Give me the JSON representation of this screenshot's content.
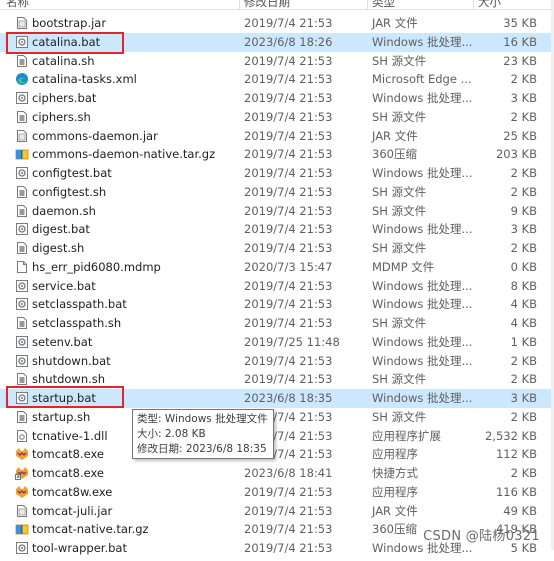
{
  "header": {
    "name": "名称",
    "date": "修改日期",
    "type": "类型",
    "size": "大小"
  },
  "rows": [
    {
      "name": "bootstrap.jar",
      "date": "2019/7/4 21:53",
      "type": "JAR 文件",
      "size": "35 KB",
      "icon": "jar-file-icon"
    },
    {
      "name": "catalina.bat",
      "date": "2023/6/8 18:26",
      "type": "Windows 批处理...",
      "size": "16 KB",
      "icon": "batch-file-icon"
    },
    {
      "name": "catalina.sh",
      "date": "2019/7/4 21:53",
      "type": "SH 源文件",
      "size": "23 KB",
      "icon": "sh-file-icon"
    },
    {
      "name": "catalina-tasks.xml",
      "date": "2019/7/4 21:53",
      "type": "Microsoft Edge ...",
      "size": "2 KB",
      "icon": "edge-xml-icon"
    },
    {
      "name": "ciphers.bat",
      "date": "2019/7/4 21:53",
      "type": "Windows 批处理...",
      "size": "3 KB",
      "icon": "batch-file-icon"
    },
    {
      "name": "ciphers.sh",
      "date": "2019/7/4 21:53",
      "type": "SH 源文件",
      "size": "2 KB",
      "icon": "sh-file-icon"
    },
    {
      "name": "commons-daemon.jar",
      "date": "2019/7/4 21:53",
      "type": "JAR 文件",
      "size": "25 KB",
      "icon": "jar-file-icon"
    },
    {
      "name": "commons-daemon-native.tar.gz",
      "date": "2019/7/4 21:53",
      "type": "360压缩",
      "size": "203 KB",
      "icon": "archive-file-icon"
    },
    {
      "name": "configtest.bat",
      "date": "2019/7/4 21:53",
      "type": "Windows 批处理...",
      "size": "2 KB",
      "icon": "batch-file-icon"
    },
    {
      "name": "configtest.sh",
      "date": "2019/7/4 21:53",
      "type": "SH 源文件",
      "size": "2 KB",
      "icon": "sh-file-icon"
    },
    {
      "name": "daemon.sh",
      "date": "2019/7/4 21:53",
      "type": "SH 源文件",
      "size": "9 KB",
      "icon": "sh-file-icon"
    },
    {
      "name": "digest.bat",
      "date": "2019/7/4 21:53",
      "type": "Windows 批处理...",
      "size": "3 KB",
      "icon": "batch-file-icon"
    },
    {
      "name": "digest.sh",
      "date": "2019/7/4 21:53",
      "type": "SH 源文件",
      "size": "2 KB",
      "icon": "sh-file-icon"
    },
    {
      "name": "hs_err_pid6080.mdmp",
      "date": "2020/7/3 15:47",
      "type": "MDMP 文件",
      "size": "0 KB",
      "icon": "blank-file-icon"
    },
    {
      "name": "service.bat",
      "date": "2019/7/4 21:53",
      "type": "Windows 批处理...",
      "size": "8 KB",
      "icon": "batch-file-icon"
    },
    {
      "name": "setclasspath.bat",
      "date": "2019/7/4 21:53",
      "type": "Windows 批处理...",
      "size": "4 KB",
      "icon": "batch-file-icon"
    },
    {
      "name": "setclasspath.sh",
      "date": "2019/7/4 21:53",
      "type": "SH 源文件",
      "size": "4 KB",
      "icon": "sh-file-icon"
    },
    {
      "name": "setenv.bat",
      "date": "2019/7/25 11:48",
      "type": "Windows 批处理...",
      "size": "1 KB",
      "icon": "batch-file-icon"
    },
    {
      "name": "shutdown.bat",
      "date": "2019/7/4 21:53",
      "type": "Windows 批处理...",
      "size": "2 KB",
      "icon": "batch-file-icon"
    },
    {
      "name": "shutdown.sh",
      "date": "2019/7/4 21:53",
      "type": "SH 源文件",
      "size": "2 KB",
      "icon": "sh-file-icon"
    },
    {
      "name": "startup.bat",
      "date": "2023/6/8 18:35",
      "type": "Windows 批处理...",
      "size": "3 KB",
      "icon": "batch-file-icon"
    },
    {
      "name": "startup.sh",
      "date": "2019/7/4 21:53",
      "type": "SH 源文件",
      "size": "2 KB",
      "icon": "sh-file-icon"
    },
    {
      "name": "tcnative-1.dll",
      "date": "2019/7/4 21:53",
      "type": "应用程序扩展",
      "size": "2,532 KB",
      "icon": "dll-file-icon"
    },
    {
      "name": "tomcat8.exe",
      "date": "2019/7/4 21:53",
      "type": "应用程序",
      "size": "112 KB",
      "icon": "tomcat-app-icon"
    },
    {
      "name": "tomcat8.exe",
      "date": "2023/6/8 18:41",
      "type": "快捷方式",
      "size": "2 KB",
      "icon": "tomcat-shortcut-icon"
    },
    {
      "name": "tomcat8w.exe",
      "date": "2019/7/4 21:53",
      "type": "应用程序",
      "size": "116 KB",
      "icon": "tomcat-app-icon"
    },
    {
      "name": "tomcat-juli.jar",
      "date": "2019/7/4 21:53",
      "type": "JAR 文件",
      "size": "49 KB",
      "icon": "jar-file-icon"
    },
    {
      "name": "tomcat-native.tar.gz",
      "date": "2019/7/4 21:53",
      "type": "360压缩",
      "size": "419 KB",
      "icon": "archive-file-icon"
    },
    {
      "name": "tool-wrapper.bat",
      "date": "2019/7/4 21:53",
      "type": "Windows 批处理...",
      "size": "5 KB",
      "icon": "batch-file-icon"
    }
  ],
  "tooltip": {
    "type_line": "类型: Windows 批处理文件",
    "size_line": "大小: 2.08 KB",
    "date_line": "修改日期: 2023/6/8 18:35"
  },
  "watermark": "CSDN @陆杨0321",
  "colors": {
    "selection": "#cce8ff",
    "highlight_box": "#e0262b"
  }
}
